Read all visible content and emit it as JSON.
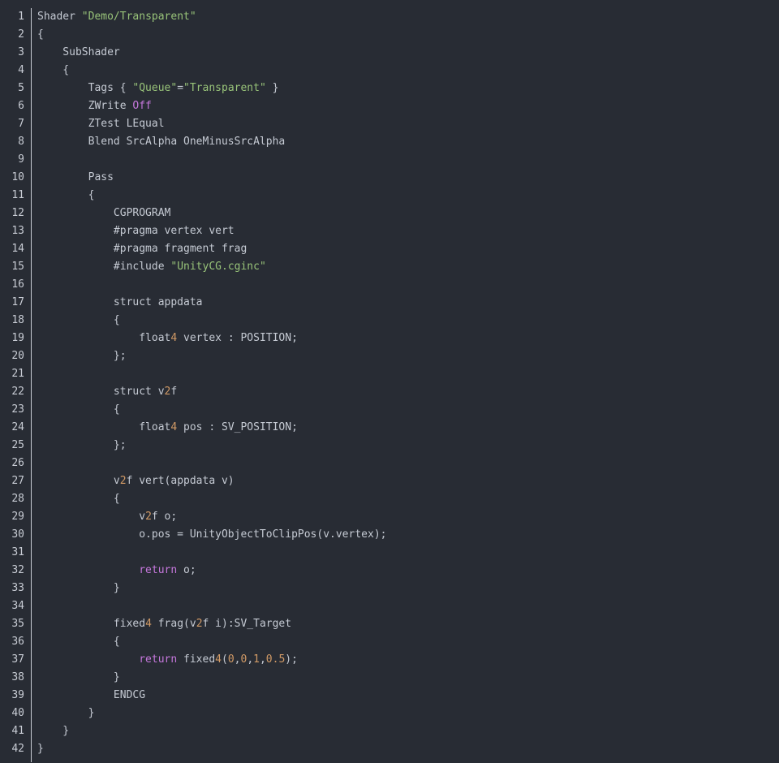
{
  "colors": {
    "background": "#282c34",
    "text": "#c5cad3",
    "string": "#98c379",
    "keyword": "#c678dd",
    "number": "#d19a66",
    "gutter": "#c8ccd4"
  },
  "code_view": {
    "lines": [
      [
        [
          "plain",
          "Shader "
        ],
        [
          "string",
          "\"Demo/Transparent\""
        ]
      ],
      [
        [
          "plain",
          "{"
        ]
      ],
      [
        [
          "plain",
          "    SubShader"
        ]
      ],
      [
        [
          "plain",
          "    {"
        ]
      ],
      [
        [
          "plain",
          "        Tags { "
        ],
        [
          "string",
          "\"Queue\""
        ],
        [
          "plain",
          "="
        ],
        [
          "string",
          "\"Transparent\""
        ],
        [
          "plain",
          " }"
        ]
      ],
      [
        [
          "plain",
          "        ZWrite "
        ],
        [
          "keyword",
          "Off"
        ]
      ],
      [
        [
          "plain",
          "        ZTest LEqual"
        ]
      ],
      [
        [
          "plain",
          "        Blend SrcAlpha OneMinusSrcAlpha"
        ]
      ],
      [
        [
          "plain",
          ""
        ]
      ],
      [
        [
          "plain",
          "        Pass"
        ]
      ],
      [
        [
          "plain",
          "        {"
        ]
      ],
      [
        [
          "plain",
          "            CGPROGRAM"
        ]
      ],
      [
        [
          "plain",
          "            #pragma vertex vert"
        ]
      ],
      [
        [
          "plain",
          "            #pragma fragment frag"
        ]
      ],
      [
        [
          "plain",
          "            #include "
        ],
        [
          "string",
          "\"UnityCG.cginc\""
        ]
      ],
      [
        [
          "plain",
          ""
        ]
      ],
      [
        [
          "plain",
          "            struct appdata"
        ]
      ],
      [
        [
          "plain",
          "            {"
        ]
      ],
      [
        [
          "plain",
          "                float"
        ],
        [
          "number",
          "4"
        ],
        [
          "plain",
          " vertex : POSITION;"
        ]
      ],
      [
        [
          "plain",
          "            };"
        ]
      ],
      [
        [
          "plain",
          ""
        ]
      ],
      [
        [
          "plain",
          "            struct v"
        ],
        [
          "number",
          "2"
        ],
        [
          "plain",
          "f"
        ]
      ],
      [
        [
          "plain",
          "            {"
        ]
      ],
      [
        [
          "plain",
          "                float"
        ],
        [
          "number",
          "4"
        ],
        [
          "plain",
          " pos : SV_POSITION;"
        ]
      ],
      [
        [
          "plain",
          "            };"
        ]
      ],
      [
        [
          "plain",
          ""
        ]
      ],
      [
        [
          "plain",
          "            v"
        ],
        [
          "number",
          "2"
        ],
        [
          "plain",
          "f vert(appdata v)"
        ]
      ],
      [
        [
          "plain",
          "            {"
        ]
      ],
      [
        [
          "plain",
          "                v"
        ],
        [
          "number",
          "2"
        ],
        [
          "plain",
          "f o;"
        ]
      ],
      [
        [
          "plain",
          "                o.pos = UnityObjectToClipPos(v.vertex);"
        ]
      ],
      [
        [
          "plain",
          ""
        ]
      ],
      [
        [
          "plain",
          "                "
        ],
        [
          "keyword",
          "return"
        ],
        [
          "plain",
          " o;"
        ]
      ],
      [
        [
          "plain",
          "            }"
        ]
      ],
      [
        [
          "plain",
          ""
        ]
      ],
      [
        [
          "plain",
          "            fixed"
        ],
        [
          "number",
          "4"
        ],
        [
          "plain",
          " frag(v"
        ],
        [
          "number",
          "2"
        ],
        [
          "plain",
          "f i):SV_Target"
        ]
      ],
      [
        [
          "plain",
          "            {"
        ]
      ],
      [
        [
          "plain",
          "                "
        ],
        [
          "keyword",
          "return"
        ],
        [
          "plain",
          " fixed"
        ],
        [
          "number",
          "4"
        ],
        [
          "plain",
          "("
        ],
        [
          "number",
          "0"
        ],
        [
          "plain",
          ","
        ],
        [
          "number",
          "0"
        ],
        [
          "plain",
          ","
        ],
        [
          "number",
          "1"
        ],
        [
          "plain",
          ","
        ],
        [
          "number",
          "0.5"
        ],
        [
          "plain",
          ");"
        ]
      ],
      [
        [
          "plain",
          "            }"
        ]
      ],
      [
        [
          "plain",
          "            ENDCG"
        ]
      ],
      [
        [
          "plain",
          "        }"
        ]
      ],
      [
        [
          "plain",
          "    }"
        ]
      ],
      [
        [
          "plain",
          "}"
        ]
      ]
    ]
  }
}
